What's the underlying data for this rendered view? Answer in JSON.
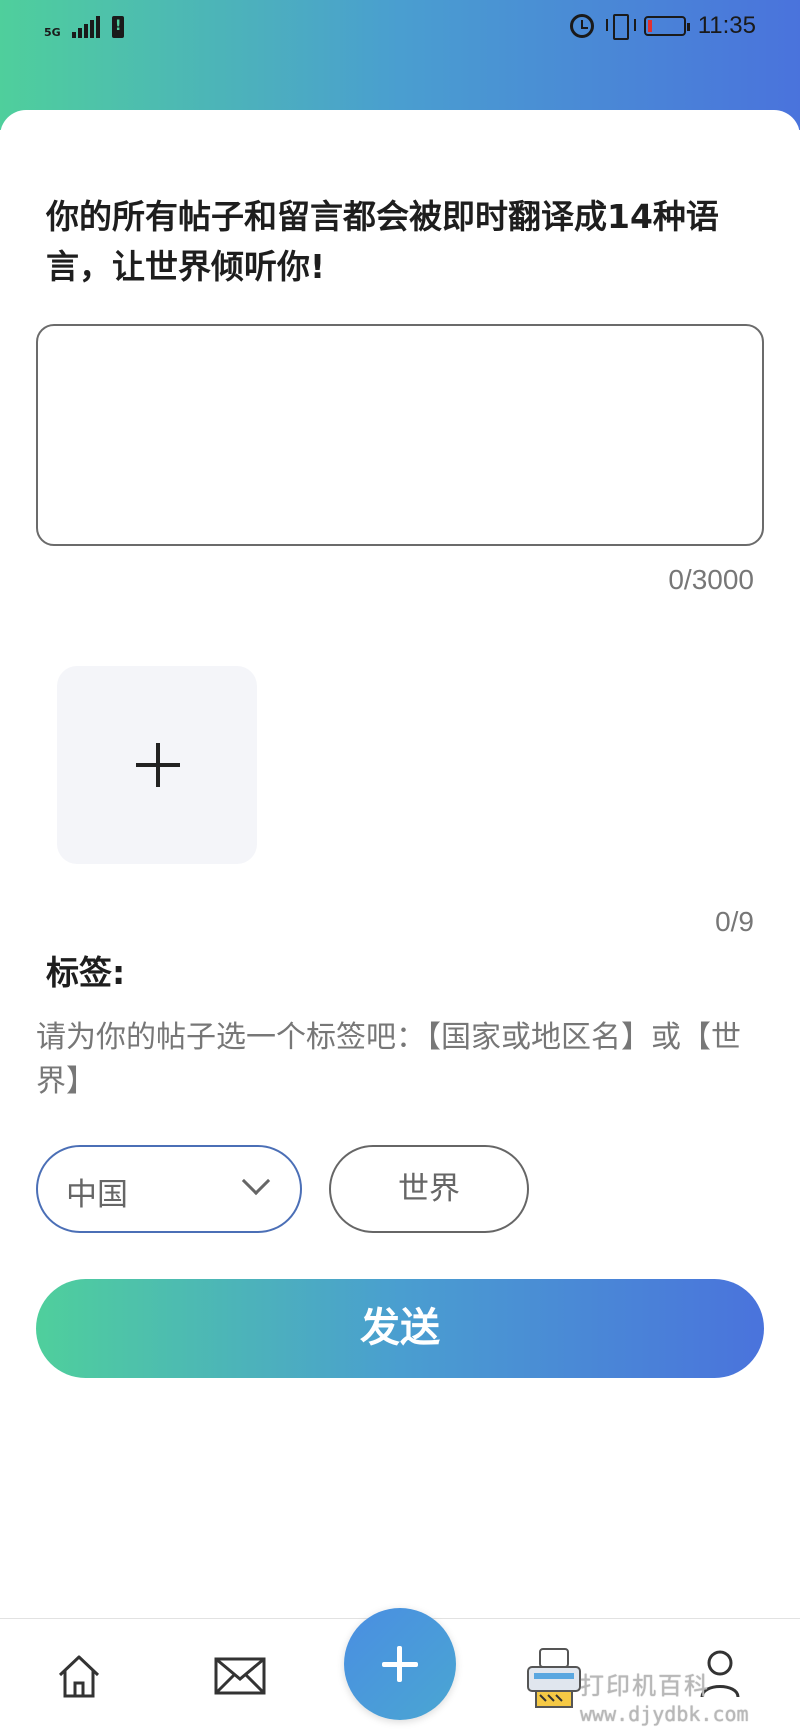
{
  "status_bar": {
    "network": "5G",
    "time": "11:35",
    "icons": [
      "signal-icon",
      "sim-alert-icon",
      "alarm-icon",
      "vibrate-icon",
      "battery-low-icon"
    ]
  },
  "compose": {
    "headline": "你的所有帖子和留言都会被即时翻译成14种语言，让世界倾听你!",
    "text_value": "",
    "char_count": "0/3000",
    "photo_count": "0/9"
  },
  "tags": {
    "label": "标签:",
    "description": "请为你的帖子选一个标签吧：【国家或地区名】或【世界】",
    "country_selected": "中国",
    "world_option": "世界"
  },
  "actions": {
    "send_label": "发送"
  },
  "bottom_nav": {
    "items": [
      "home-icon",
      "mail-icon",
      "add-icon",
      "printer-icon",
      "profile-icon"
    ]
  },
  "watermark": {
    "line1": "打印机百科",
    "line2": "www.djydbk.com"
  },
  "colors": {
    "gradient_start": "#4fcf9c",
    "gradient_end": "#4a73dc",
    "select_border": "#4b6fb6"
  }
}
